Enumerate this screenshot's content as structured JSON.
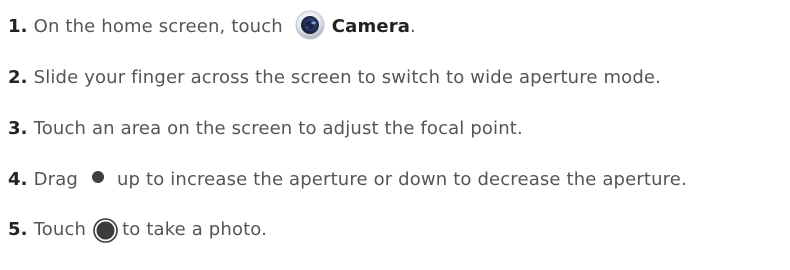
{
  "steps": [
    {
      "number": "1.",
      "before": "On the home screen, touch",
      "icon": "camera-app-icon",
      "app": "Camera",
      "after": "."
    },
    {
      "number": "2.",
      "text": "Slide your finger across the screen to switch to wide aperture mode."
    },
    {
      "number": "3.",
      "text": "Touch an area on the screen to adjust the focal point."
    },
    {
      "number": "4.",
      "before": "Drag",
      "icon": "aperture-slider-dot-icon",
      "after": "up to increase the aperture or down to decrease the aperture."
    },
    {
      "number": "5.",
      "before": "Touch",
      "icon": "shutter-button-icon",
      "after": "to take a photo."
    }
  ],
  "colors": {
    "text": "#555555",
    "number": "#222222",
    "camera_ring": "#dfe3ea",
    "camera_lens": "#20304b",
    "camera_glint": "#8fa6ff"
  }
}
